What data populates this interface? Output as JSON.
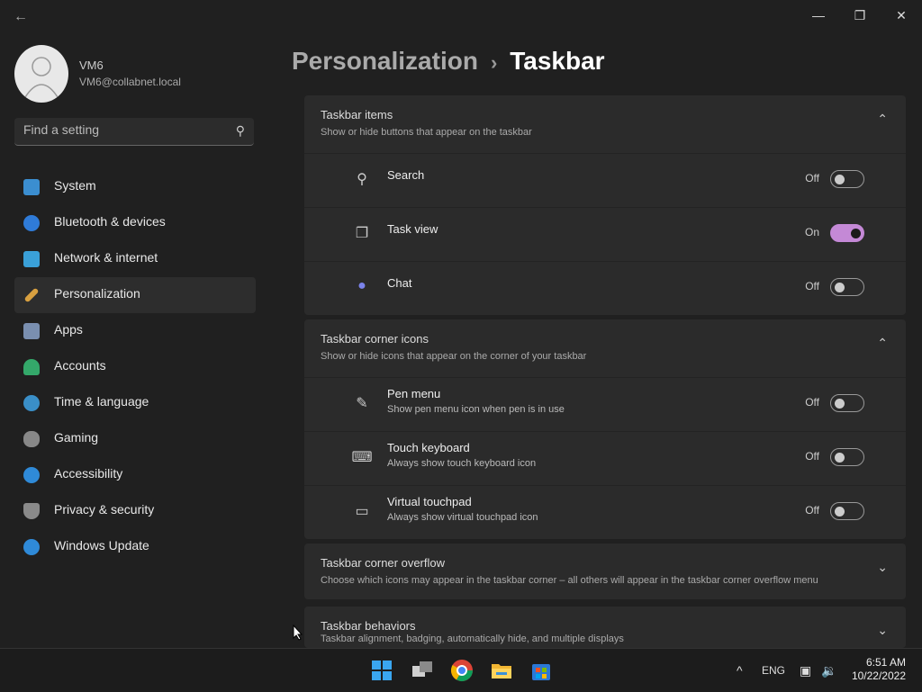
{
  "window": {
    "back_icon": "back-arrow-icon",
    "minimize": "—",
    "maximize": "❐",
    "close": "✕"
  },
  "user": {
    "name": "VM6",
    "email": "VM6@collabnet.local"
  },
  "search": {
    "placeholder": "Find a setting"
  },
  "nav": [
    {
      "label": "System",
      "icon": "system-icon",
      "color": "#3b8ed0"
    },
    {
      "label": "Bluetooth & devices",
      "icon": "bluetooth-icon",
      "color": "#2f7bd8"
    },
    {
      "label": "Network & internet",
      "icon": "wifi-icon",
      "color": "#3aa0d8"
    },
    {
      "label": "Personalization",
      "icon": "brush-icon",
      "color": "#d8a040"
    },
    {
      "label": "Apps",
      "icon": "apps-icon",
      "color": "#7a8fb0"
    },
    {
      "label": "Accounts",
      "icon": "person-icon",
      "color": "#34a86a"
    },
    {
      "label": "Time & language",
      "icon": "globe-icon",
      "color": "#3a8fc8"
    },
    {
      "label": "Gaming",
      "icon": "gamepad-icon",
      "color": "#888888"
    },
    {
      "label": "Accessibility",
      "icon": "accessibility-icon",
      "color": "#2f8ad8"
    },
    {
      "label": "Privacy & security",
      "icon": "shield-icon",
      "color": "#8a8a8a"
    },
    {
      "label": "Windows Update",
      "icon": "update-icon",
      "color": "#2f8ad8"
    }
  ],
  "breadcrumb": {
    "parent": "Personalization",
    "separator": "›",
    "current": "Taskbar"
  },
  "sections": {
    "items": {
      "title": "Taskbar items",
      "description": "Show or hide buttons that appear on the taskbar",
      "rows": [
        {
          "label": "Search",
          "state": "Off"
        },
        {
          "label": "Task view",
          "state": "On"
        },
        {
          "label": "Chat",
          "state": "Off"
        }
      ]
    },
    "corner_icons": {
      "title": "Taskbar corner icons",
      "description": "Show or hide icons that appear on the corner of your taskbar",
      "rows": [
        {
          "label": "Pen menu",
          "description": "Show pen menu icon when pen is in use",
          "state": "Off"
        },
        {
          "label": "Touch keyboard",
          "description": "Always show touch keyboard icon",
          "state": "Off"
        },
        {
          "label": "Virtual touchpad",
          "description": "Always show virtual touchpad icon",
          "state": "Off"
        }
      ]
    },
    "overflow": {
      "title": "Taskbar corner overflow",
      "description": "Choose which icons may appear in the taskbar corner – all others will appear in the taskbar corner overflow menu"
    },
    "behaviors": {
      "title": "Taskbar behaviors",
      "description": "Taskbar alignment, badging, automatically hide, and multiple displays"
    }
  },
  "taskbar": {
    "apps": [
      "start-icon",
      "task-view-icon",
      "chrome-icon",
      "file-explorer-icon",
      "store-icon"
    ],
    "tray_chevron": "^",
    "language": "ENG",
    "time": "6:51 AM",
    "date": "10/22/2022"
  }
}
